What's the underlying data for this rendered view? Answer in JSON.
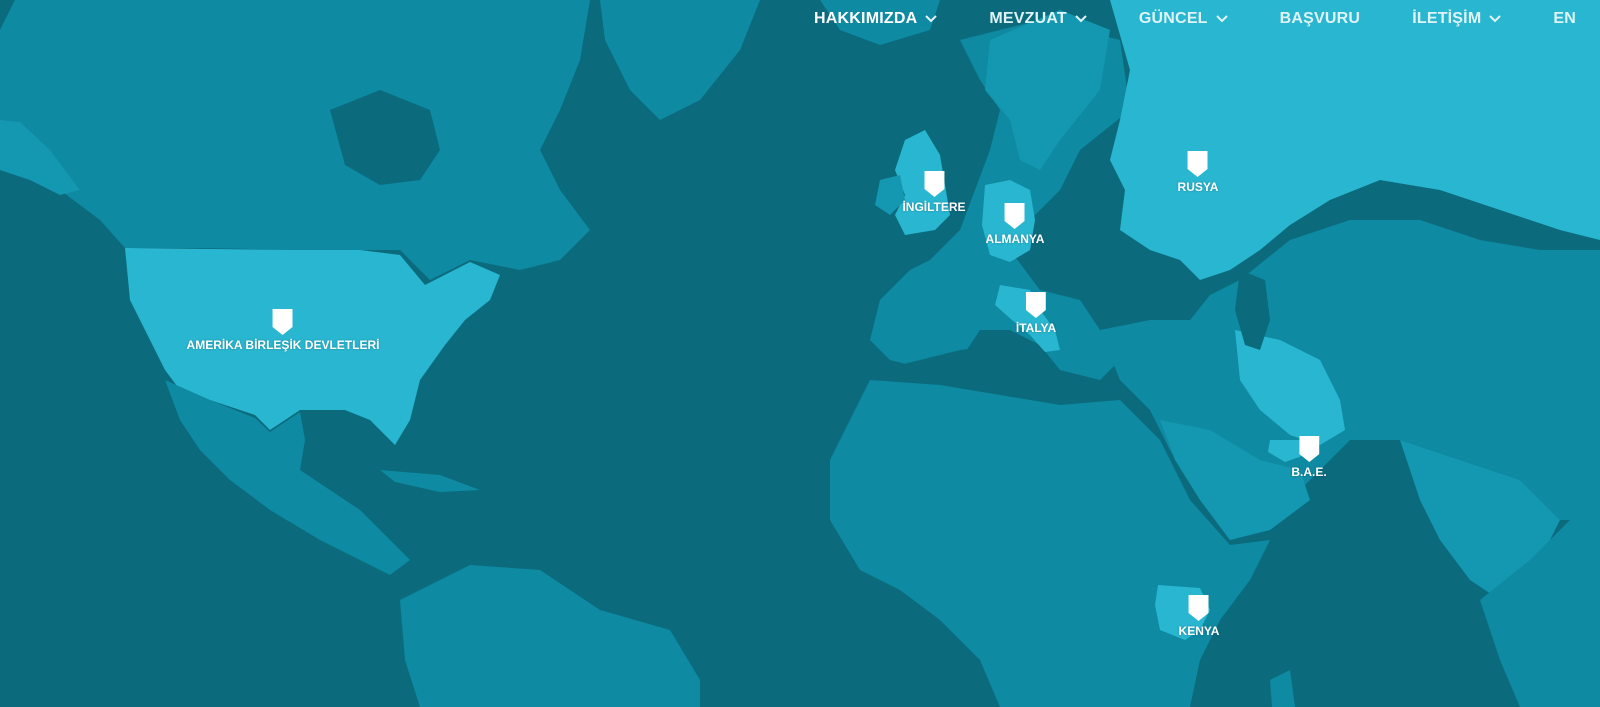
{
  "colors": {
    "ocean": "#0b6b7d",
    "land": "#0e8aa2",
    "land_alt": "#1497b0",
    "highlight": "#29b6d0",
    "marker": "#ffffff"
  },
  "nav": {
    "items": [
      {
        "label": "HAKKIMIZDA",
        "dropdown": true,
        "active": true
      },
      {
        "label": "MEVZUAT",
        "dropdown": true,
        "active": false
      },
      {
        "label": "GÜNCEL",
        "dropdown": true,
        "active": false
      },
      {
        "label": "BAŞVURU",
        "dropdown": false,
        "active": false
      },
      {
        "label": "İLETİŞİM",
        "dropdown": true,
        "active": false
      }
    ],
    "language": "EN"
  },
  "markers": [
    {
      "label": "AMERİKA BİRLEŞİK DEVLETLERİ",
      "icon": "map-pin-icon"
    },
    {
      "label": "İNGİLTERE",
      "icon": "map-pin-icon"
    },
    {
      "label": "ALMANYA",
      "icon": "map-pin-icon"
    },
    {
      "label": "RUSYA",
      "icon": "map-pin-icon"
    },
    {
      "label": "İTALYA",
      "icon": "map-pin-icon"
    },
    {
      "label": "B.A.E.",
      "icon": "map-pin-icon"
    },
    {
      "label": "KENYA",
      "icon": "map-pin-icon"
    }
  ]
}
